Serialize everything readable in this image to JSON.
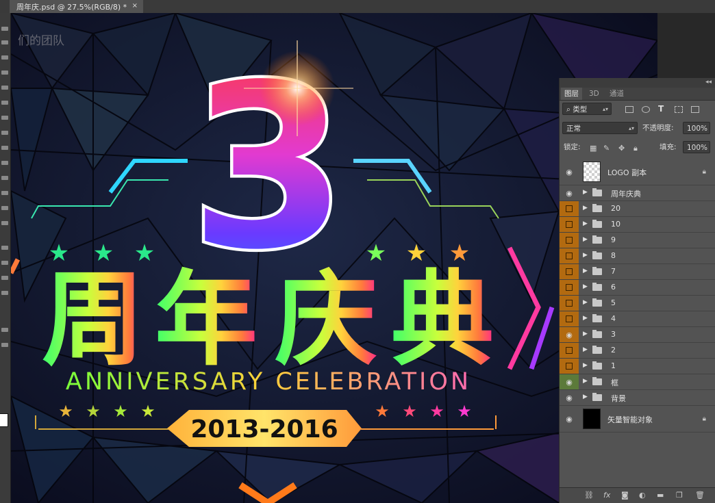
{
  "document": {
    "tab_title": "周年庆.psd @ 27.5%(RGB/8) *",
    "close": "×"
  },
  "artwork": {
    "watermark": "们的团队",
    "numeral": "3",
    "title_chars": [
      "周",
      "年",
      "庆",
      "典"
    ],
    "subtitle": "ANNIVERSARY CELEBRATION",
    "years": "2013-2016"
  },
  "panel": {
    "collapse": "◂◂",
    "tabs": [
      "图层",
      "3D",
      "通道"
    ],
    "filter_kind": "类型",
    "blend_mode": "正常",
    "opacity_label": "不透明度:",
    "opacity_value": "100%",
    "lock_label": "锁定:",
    "fill_label": "填充:",
    "fill_value": "100%",
    "layers": [
      {
        "name": "LOGO 副本",
        "kind": "smart",
        "thumb": "checker",
        "visible": true,
        "color": "none",
        "locked": true
      },
      {
        "name": "周年庆典",
        "kind": "group",
        "visible": true,
        "color": "none"
      },
      {
        "name": "20",
        "kind": "group",
        "visible": false,
        "color": "orange"
      },
      {
        "name": "10",
        "kind": "group",
        "visible": false,
        "color": "orange"
      },
      {
        "name": "9",
        "kind": "group",
        "visible": false,
        "color": "orange"
      },
      {
        "name": "8",
        "kind": "group",
        "visible": false,
        "color": "orange"
      },
      {
        "name": "7",
        "kind": "group",
        "visible": false,
        "color": "orange"
      },
      {
        "name": "6",
        "kind": "group",
        "visible": false,
        "color": "orange"
      },
      {
        "name": "5",
        "kind": "group",
        "visible": false,
        "color": "orange"
      },
      {
        "name": "4",
        "kind": "group",
        "visible": false,
        "color": "orange"
      },
      {
        "name": "3",
        "kind": "group",
        "visible": true,
        "color": "orange"
      },
      {
        "name": "2",
        "kind": "group",
        "visible": false,
        "color": "orange"
      },
      {
        "name": "1",
        "kind": "group",
        "visible": false,
        "color": "orange"
      },
      {
        "name": "框",
        "kind": "group",
        "visible": true,
        "color": "green"
      },
      {
        "name": "背景",
        "kind": "group",
        "visible": true,
        "color": "none"
      },
      {
        "name": "矢量智能对象",
        "kind": "smart",
        "thumb": "black",
        "visible": true,
        "color": "none",
        "locked": true
      }
    ],
    "colors": {
      "orange": "#b26a10",
      "green": "#5c7a3a",
      "panel_bg": "#535353"
    }
  }
}
